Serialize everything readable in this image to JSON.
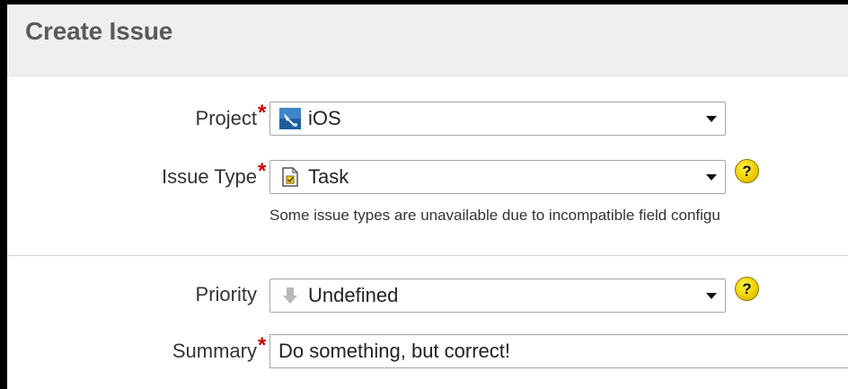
{
  "dialog": {
    "title": "Create Issue"
  },
  "fields": {
    "project": {
      "label": "Project",
      "required_marker": "*",
      "selected_value": "iOS",
      "icon": "ios-project-icon"
    },
    "issue_type": {
      "label": "Issue Type",
      "required_marker": "*",
      "selected_value": "Task",
      "icon": "task-icon",
      "help": "?",
      "description": "Some issue types are unavailable due to incompatible field configu"
    },
    "priority": {
      "label": "Priority",
      "selected_value": "Undefined",
      "icon": "down-arrow-priority-icon",
      "help": "?"
    },
    "summary": {
      "label": "Summary",
      "required_marker": "*",
      "value": "Do something, but correct!"
    }
  },
  "colors": {
    "required": "#cc0000",
    "help_icon": "#f0cf00",
    "header_bg": "#efefef"
  }
}
